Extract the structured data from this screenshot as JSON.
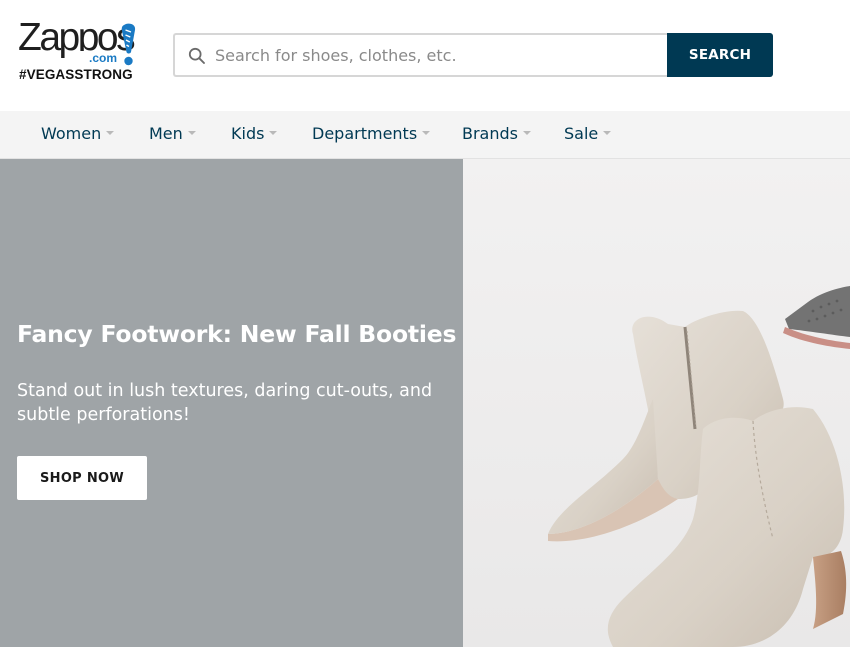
{
  "brand": {
    "name": "Zappos",
    "domain_suffix": ".com",
    "hashtag": "#VEGASSTRONG",
    "accent_color": "#1a7ac4",
    "primary_color": "#003953"
  },
  "search": {
    "placeholder": "Search for shoes, clothes, etc.",
    "value": "",
    "button_label": "SEARCH",
    "icon": "search-icon"
  },
  "nav": {
    "items": [
      {
        "label": "Women",
        "icon": "chevron-down-icon"
      },
      {
        "label": "Men",
        "icon": "chevron-down-icon"
      },
      {
        "label": "Kids",
        "icon": "chevron-down-icon"
      },
      {
        "label": "Departments",
        "icon": "chevron-down-icon"
      },
      {
        "label": "Brands",
        "icon": "chevron-down-icon"
      },
      {
        "label": "Sale",
        "icon": "chevron-down-icon"
      }
    ]
  },
  "hero": {
    "title": "Fancy Footwork: New Fall Booties",
    "subtitle": "Stand out in lush textures, daring cut-outs, and subtle perforations!",
    "cta_label": "SHOP NOW",
    "panel_color": "#9fa4a7",
    "image": "suede-ankle-booties-image"
  }
}
